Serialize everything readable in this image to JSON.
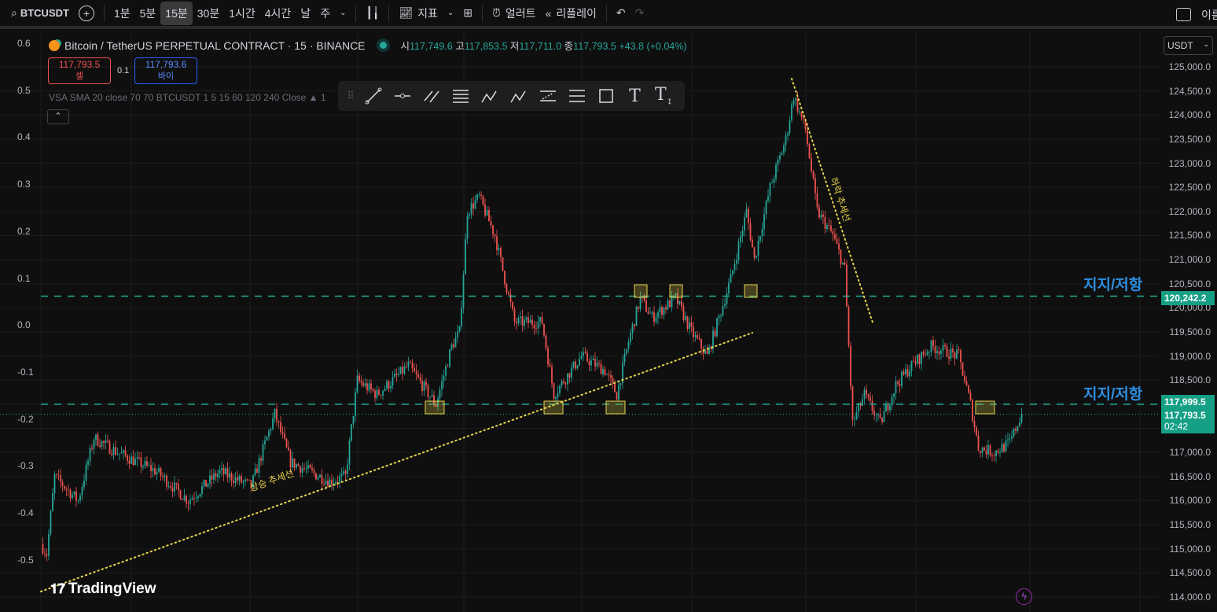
{
  "toolbar": {
    "symbol": "BTCUSDT",
    "intervals": [
      "1분",
      "5분",
      "15분",
      "30분",
      "1시간",
      "4시간",
      "날",
      "주"
    ],
    "active_interval": "15분",
    "indicators": "지표",
    "alert": "얼러트",
    "replay": "리플레이",
    "right_text": "이름"
  },
  "legend": {
    "title": "Bitcoin / TetherUS PERPETUAL CONTRACT · 15 · BINANCE",
    "o_label": "시",
    "o": "117,749.6",
    "h_label": "고",
    "h": "117,853.5",
    "l_label": "저",
    "l": "117,711.0",
    "c_label": "종",
    "c": "117,793.5",
    "change": "+43.8 (+0.04%)",
    "sell_price": "117,793.5",
    "sell_label": "셀",
    "spread": "0.1",
    "buy_price": "117,793.6",
    "buy_label": "바이",
    "indicator": "VSA SMA 20 close 70 70 BTCUSDT 1 5 15 60 120 240 Close ▲ 1"
  },
  "axis": {
    "currency": "USDT",
    "ticks": [
      "125,000.0",
      "124,500.0",
      "124,000.0",
      "123,500.0",
      "123,000.0",
      "122,500.0",
      "122,000.0",
      "121,500.0",
      "121,000.0",
      "120,500.0",
      "120,000.0",
      "119,500.0",
      "119,000.0",
      "118,500.0",
      "118,000.0",
      "117,500.0",
      "117,000.0",
      "116,500.0",
      "116,000.0",
      "115,500.0",
      "115,000.0",
      "114,500.0",
      "114,000.0"
    ],
    "left_ticks": [
      "0.6",
      "0.5",
      "0.4",
      "0.3",
      "0.2",
      "0.1",
      "0.0",
      "-0.1",
      "-0.2",
      "-0.3",
      "-0.4",
      "-0.5"
    ],
    "resistance_label": "120,242.2",
    "support_label": "117,999.5",
    "last_price": "117,793.5",
    "countdown": "02:42"
  },
  "annotations": {
    "sr_upper": "지지/저항",
    "sr_lower": "지지/저항",
    "uptrend": "상승 추세선",
    "downtrend": "하락 추세선"
  },
  "brand": "TradingView",
  "colors": {
    "up": "#26a69a",
    "down": "#ef5350",
    "trend": "#e8d44d",
    "level": "#22ab94"
  },
  "chart_data": {
    "type": "candlestick",
    "symbol": "BTCUSDT",
    "interval": "15",
    "ylim": [
      114000,
      125000
    ],
    "path": [
      [
        0,
        115100
      ],
      [
        3,
        114900
      ],
      [
        7,
        116500
      ],
      [
        19,
        116000
      ],
      [
        27,
        117300
      ],
      [
        39,
        117000
      ],
      [
        59,
        116600
      ],
      [
        75,
        116000
      ],
      [
        91,
        116600
      ],
      [
        107,
        116300
      ],
      [
        119,
        117800
      ],
      [
        127,
        116800
      ],
      [
        147,
        116400
      ],
      [
        155,
        116500
      ],
      [
        161,
        118500
      ],
      [
        171,
        118200
      ],
      [
        187,
        118800
      ],
      [
        201,
        118000
      ],
      [
        209,
        119200
      ],
      [
        213,
        119500
      ],
      [
        217,
        122000
      ],
      [
        223,
        122300
      ],
      [
        231,
        121500
      ],
      [
        241,
        119700
      ],
      [
        255,
        119700
      ],
      [
        261,
        118200
      ],
      [
        275,
        119000
      ],
      [
        287,
        118700
      ],
      [
        293,
        118200
      ],
      [
        299,
        119300
      ],
      [
        305,
        120200
      ],
      [
        311,
        119800
      ],
      [
        323,
        120200
      ],
      [
        331,
        119500
      ],
      [
        339,
        119000
      ],
      [
        351,
        120600
      ],
      [
        359,
        122000
      ],
      [
        363,
        121000
      ],
      [
        371,
        122500
      ],
      [
        379,
        123500
      ],
      [
        383,
        124400
      ],
      [
        389,
        123700
      ],
      [
        395,
        122000
      ],
      [
        403,
        121500
      ],
      [
        409,
        120800
      ],
      [
        413,
        117600
      ],
      [
        419,
        118200
      ],
      [
        427,
        117600
      ],
      [
        435,
        118400
      ],
      [
        443,
        118800
      ],
      [
        453,
        119200
      ],
      [
        467,
        119000
      ],
      [
        473,
        118000
      ],
      [
        477,
        117100
      ],
      [
        485,
        117000
      ],
      [
        493,
        117200
      ],
      [
        499,
        117800
      ]
    ],
    "levels": [
      120242.2,
      117999.5
    ],
    "last": 117793.5
  }
}
